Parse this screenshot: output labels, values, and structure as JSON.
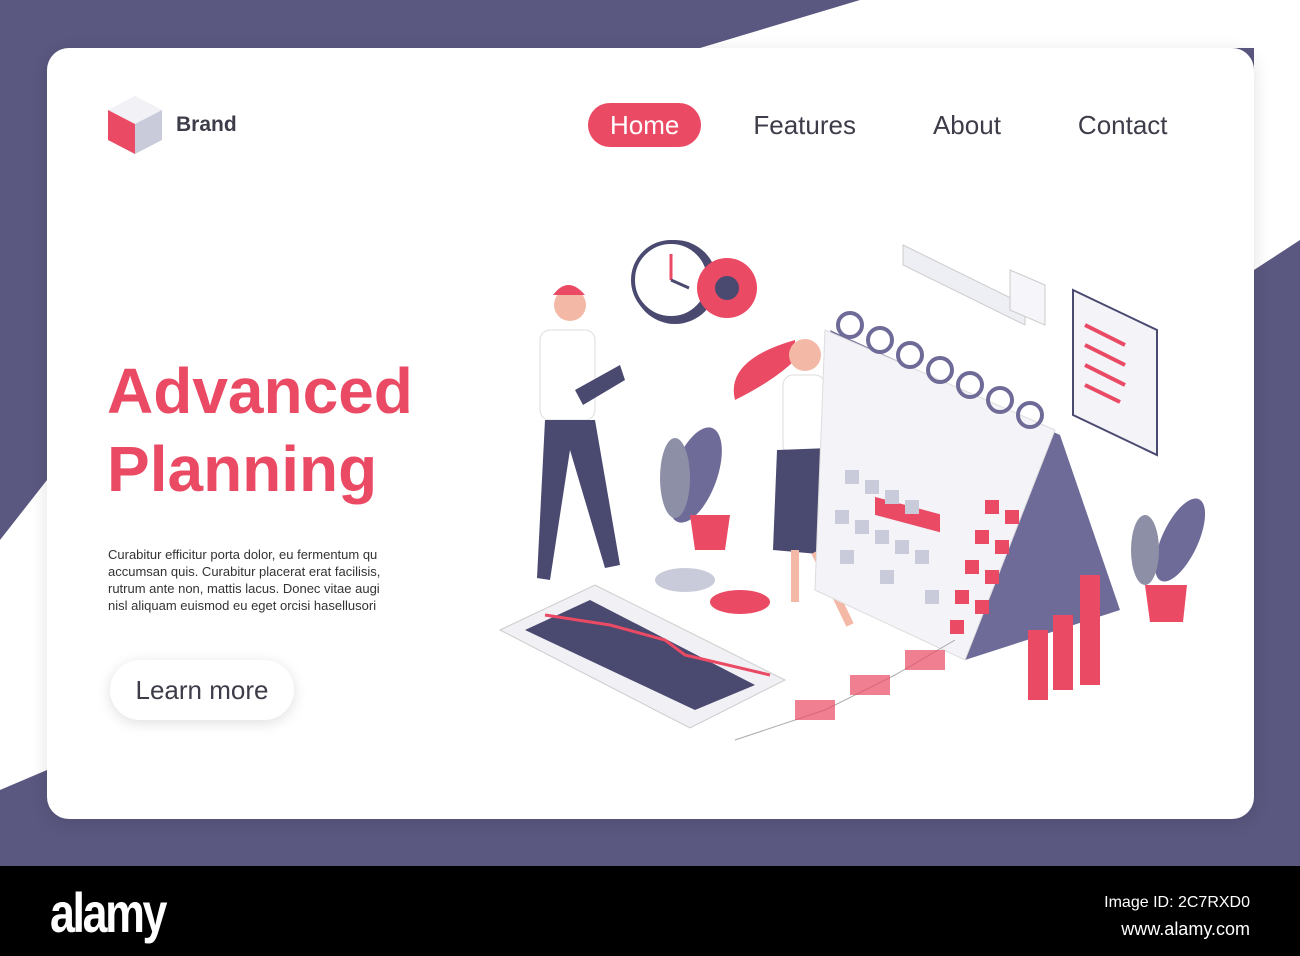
{
  "brand": {
    "name": "Brand"
  },
  "nav": [
    {
      "label": "Home",
      "active": true
    },
    {
      "label": "Features"
    },
    {
      "label": "About"
    },
    {
      "label": "Contact"
    }
  ],
  "hero": {
    "title_line1": "Advanced",
    "title_line2": "Planning",
    "body": "Curabitur efficitur porta dolor, eu fermentum qu\naccumsan quis. Curabitur placerat erat facilisis,\nrutrum ante non, mattis lacus. Donec vitae augi\nnisl aliquam euismod eu eget orcisi  hasellusori",
    "cta": "Learn more"
  },
  "colors": {
    "accent": "#ea4a63",
    "frame": "#5a5880"
  },
  "watermark": {
    "logo": "alamy",
    "image_id": "Image ID: 2C7RXD0",
    "url": "www.alamy.com"
  }
}
